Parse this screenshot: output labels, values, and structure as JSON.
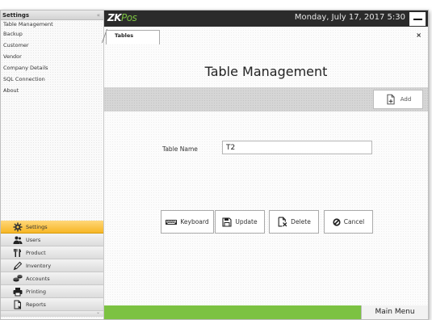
{
  "sidebar": {
    "title": "Settings",
    "collapse_glyph": "«",
    "items": [
      {
        "label": "Table Management"
      },
      {
        "label": "Backup"
      },
      {
        "label": "Customer"
      },
      {
        "label": "Vendor"
      },
      {
        "label": "Company Details"
      },
      {
        "label": "SQL Connection"
      },
      {
        "label": "About"
      }
    ],
    "nav": [
      {
        "label": "Settings",
        "icon": "gear-icon",
        "active": true
      },
      {
        "label": "Users",
        "icon": "users-icon",
        "active": false
      },
      {
        "label": "Product",
        "icon": "utensils-icon",
        "active": false
      },
      {
        "label": "Inventory",
        "icon": "pencil-icon",
        "active": false
      },
      {
        "label": "Accounts",
        "icon": "coins-icon",
        "active": false
      },
      {
        "label": "Printing",
        "icon": "printer-icon",
        "active": false
      },
      {
        "label": "Reports",
        "icon": "report-icon",
        "active": false
      }
    ],
    "footer_glyph": "⌄"
  },
  "header": {
    "logo_brand": "ZK",
    "logo_suffix": "Pos",
    "datetime": "Monday, July 17, 2017 5:30",
    "minimize_icon": "minimize-icon"
  },
  "tabs": [
    {
      "label": "Tables",
      "active": true
    }
  ],
  "tab_close": "×",
  "main": {
    "title": "Table Management",
    "add_label": "Add",
    "field": {
      "label": "Table Name",
      "value": "T2"
    },
    "buttons": {
      "keyboard": "Keyboard",
      "update": "Update",
      "delete": "Delete",
      "cancel": "Cancel"
    },
    "main_menu": "Main Menu"
  },
  "colors": {
    "accent_green": "#7cc242",
    "active_nav": "#f7b625",
    "topbar": "#2b2b2b"
  }
}
